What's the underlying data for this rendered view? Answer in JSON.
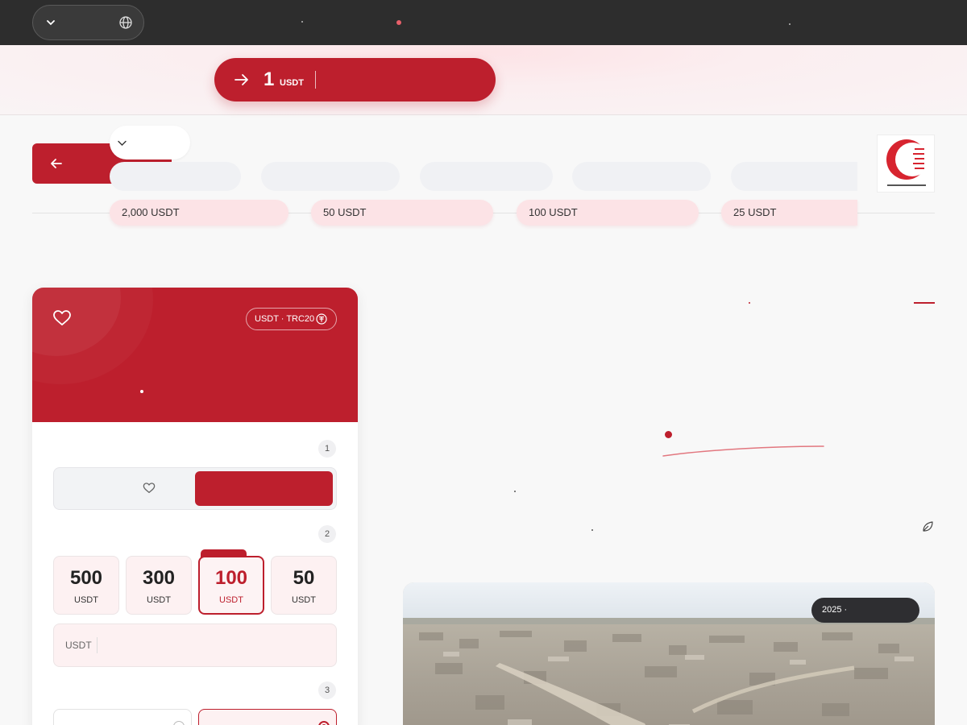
{
  "banner": {
    "amount": "1",
    "unit": "USDT"
  },
  "campaign_amounts": [
    {
      "label": "2,000 USDT"
    },
    {
      "label": "50 USDT"
    },
    {
      "label": "100 USDT"
    },
    {
      "label": "25 USDT"
    }
  ],
  "card": {
    "network_badge": "USDT · TRC20",
    "steps": [
      "1",
      "2",
      "3"
    ],
    "presets": [
      {
        "value": "500",
        "currency": "USDT"
      },
      {
        "value": "300",
        "currency": "USDT"
      },
      {
        "value": "100",
        "currency": "USDT",
        "selected": true
      },
      {
        "value": "50",
        "currency": "USDT"
      }
    ],
    "custom_amount_currency": "USDT",
    "custom_amount_value": ""
  },
  "photo": {
    "year_badge": "2025 ·"
  },
  "colors": {
    "brand_red": "#bd1f2d",
    "topbar": "#2d2d2d",
    "chip_pink": "#fce3e6"
  },
  "icons": [
    "chevron-down-icon",
    "globe-icon",
    "arrow-right-icon",
    "arrow-left-icon",
    "heart-icon",
    "tether-icon",
    "leaf-icon"
  ]
}
